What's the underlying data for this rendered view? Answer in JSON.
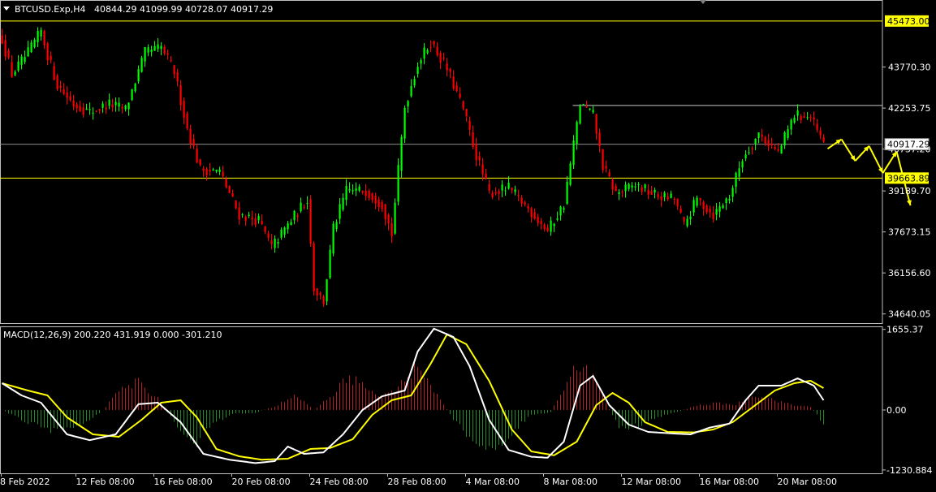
{
  "header": {
    "symbol_timeframe": "BTCUSD.Exp,H4",
    "ohlc": "40844.29 41099.99 40728.07 40917.29"
  },
  "macd_header": "MACD(12,26,9) 200.220 431.919 0.000 -301.210",
  "colors": {
    "background": "#000000",
    "bull_candle": "#00ff00",
    "bear_candle": "#ff0000",
    "grid_axis": "#c0c0c0",
    "level_line": "#ffff00",
    "macd_line": "#ffffff",
    "signal_line": "#ffff00",
    "hist_pos": "#b22222",
    "hist_neg": "#228b22",
    "arrow": "#ffff00"
  },
  "chart_data": [
    {
      "type": "candlestick",
      "panel": "price",
      "ylim": [
        34300,
        46250
      ],
      "y_ticks": [
        "43770.30",
        "42253.75",
        "40737.20",
        "39189.70",
        "37673.15",
        "36156.60",
        "34640.05"
      ],
      "horizontal_levels": [
        {
          "value": 45473.0,
          "label": "45473.00",
          "style": "yellow"
        },
        {
          "value": 40917.29,
          "label": "40917.29",
          "style": "gray"
        },
        {
          "value": 39663.89,
          "label": "39663.89",
          "style": "yellow"
        }
      ],
      "resistance_segment": {
        "value": 42350,
        "from": "8 Mar 08:00"
      },
      "close_path": [
        {
          "i": 0,
          "v": 44800
        },
        {
          "i": 3,
          "v": 43500
        },
        {
          "i": 8,
          "v": 44300
        },
        {
          "i": 12,
          "v": 45100
        },
        {
          "i": 14,
          "v": 44200
        },
        {
          "i": 17,
          "v": 43100
        },
        {
          "i": 22,
          "v": 42400
        },
        {
          "i": 27,
          "v": 42100
        },
        {
          "i": 33,
          "v": 42400
        },
        {
          "i": 38,
          "v": 42200
        },
        {
          "i": 44,
          "v": 44300
        },
        {
          "i": 49,
          "v": 44500
        },
        {
          "i": 53,
          "v": 43600
        },
        {
          "i": 57,
          "v": 41500
        },
        {
          "i": 61,
          "v": 40000
        },
        {
          "i": 67,
          "v": 39900
        },
        {
          "i": 73,
          "v": 38300
        },
        {
          "i": 79,
          "v": 38100
        },
        {
          "i": 83,
          "v": 37100
        },
        {
          "i": 89,
          "v": 38100
        },
        {
          "i": 94,
          "v": 38900
        },
        {
          "i": 96,
          "v": 35600
        },
        {
          "i": 99,
          "v": 35100
        },
        {
          "i": 102,
          "v": 37800
        },
        {
          "i": 106,
          "v": 39200
        },
        {
          "i": 112,
          "v": 39200
        },
        {
          "i": 117,
          "v": 38700
        },
        {
          "i": 120,
          "v": 37600
        },
        {
          "i": 124,
          "v": 42300
        },
        {
          "i": 128,
          "v": 43900
        },
        {
          "i": 132,
          "v": 44700
        },
        {
          "i": 137,
          "v": 43700
        },
        {
          "i": 142,
          "v": 42200
        },
        {
          "i": 146,
          "v": 40500
        },
        {
          "i": 150,
          "v": 39100
        },
        {
          "i": 156,
          "v": 39300
        },
        {
          "i": 163,
          "v": 38400
        },
        {
          "i": 168,
          "v": 37700
        },
        {
          "i": 173,
          "v": 38700
        },
        {
          "i": 178,
          "v": 42400
        },
        {
          "i": 182,
          "v": 42000
        },
        {
          "i": 185,
          "v": 40100
        },
        {
          "i": 189,
          "v": 39100
        },
        {
          "i": 195,
          "v": 39400
        },
        {
          "i": 202,
          "v": 39000
        },
        {
          "i": 207,
          "v": 38900
        },
        {
          "i": 210,
          "v": 37900
        },
        {
          "i": 214,
          "v": 38900
        },
        {
          "i": 219,
          "v": 38300
        },
        {
          "i": 224,
          "v": 39000
        },
        {
          "i": 228,
          "v": 40400
        },
        {
          "i": 233,
          "v": 41300
        },
        {
          "i": 239,
          "v": 40600
        },
        {
          "i": 244,
          "v": 42000
        },
        {
          "i": 249,
          "v": 41900
        },
        {
          "i": 253,
          "v": 40900
        }
      ],
      "n_bars": 254,
      "projection_arrows": [
        {
          "from": [
            40750,
            0
          ],
          "to": [
            41100,
            1
          ]
        },
        {
          "from": [
            41100,
            1
          ],
          "to": [
            40300,
            2
          ]
        },
        {
          "from": [
            40300,
            2
          ],
          "to": [
            40850,
            3
          ]
        },
        {
          "from": [
            40850,
            3
          ],
          "to": [
            39850,
            4
          ]
        },
        {
          "from": [
            39850,
            4
          ],
          "to": [
            40650,
            5
          ]
        },
        {
          "from": [
            40650,
            5
          ],
          "to": [
            38650,
            6
          ]
        }
      ]
    },
    {
      "type": "macd",
      "panel": "indicator",
      "ylim": [
        -1300,
        1700
      ],
      "y_ticks": [
        "1655.37",
        "0.00",
        "-1230.884"
      ],
      "macd_line": [
        {
          "i": 0,
          "v": 550
        },
        {
          "i": 6,
          "v": 300
        },
        {
          "i": 12,
          "v": 150
        },
        {
          "i": 20,
          "v": -500
        },
        {
          "i": 27,
          "v": -620
        },
        {
          "i": 35,
          "v": -500
        },
        {
          "i": 42,
          "v": 120
        },
        {
          "i": 48,
          "v": 150
        },
        {
          "i": 55,
          "v": -250
        },
        {
          "i": 62,
          "v": -900
        },
        {
          "i": 70,
          "v": -1020
        },
        {
          "i": 78,
          "v": -1090
        },
        {
          "i": 84,
          "v": -1050
        },
        {
          "i": 88,
          "v": -750
        },
        {
          "i": 93,
          "v": -900
        },
        {
          "i": 99,
          "v": -870
        },
        {
          "i": 105,
          "v": -500
        },
        {
          "i": 111,
          "v": 0
        },
        {
          "i": 117,
          "v": 280
        },
        {
          "i": 124,
          "v": 400
        },
        {
          "i": 128,
          "v": 1200
        },
        {
          "i": 133,
          "v": 1670
        },
        {
          "i": 139,
          "v": 1500
        },
        {
          "i": 144,
          "v": 900
        },
        {
          "i": 150,
          "v": -200
        },
        {
          "i": 156,
          "v": -820
        },
        {
          "i": 163,
          "v": -960
        },
        {
          "i": 168,
          "v": -980
        },
        {
          "i": 173,
          "v": -650
        },
        {
          "i": 178,
          "v": 500
        },
        {
          "i": 182,
          "v": 700
        },
        {
          "i": 187,
          "v": 100
        },
        {
          "i": 193,
          "v": -300
        },
        {
          "i": 199,
          "v": -450
        },
        {
          "i": 206,
          "v": -480
        },
        {
          "i": 212,
          "v": -500
        },
        {
          "i": 218,
          "v": -360
        },
        {
          "i": 224,
          "v": -280
        },
        {
          "i": 229,
          "v": 200
        },
        {
          "i": 233,
          "v": 500
        },
        {
          "i": 240,
          "v": 500
        },
        {
          "i": 245,
          "v": 650
        },
        {
          "i": 250,
          "v": 500
        },
        {
          "i": 253,
          "v": 200
        }
      ],
      "signal_line": [
        {
          "i": 0,
          "v": 550
        },
        {
          "i": 8,
          "v": 400
        },
        {
          "i": 14,
          "v": 300
        },
        {
          "i": 20,
          "v": -150
        },
        {
          "i": 28,
          "v": -500
        },
        {
          "i": 36,
          "v": -550
        },
        {
          "i": 43,
          "v": -200
        },
        {
          "i": 49,
          "v": 150
        },
        {
          "i": 55,
          "v": 200
        },
        {
          "i": 60,
          "v": -150
        },
        {
          "i": 66,
          "v": -800
        },
        {
          "i": 73,
          "v": -950
        },
        {
          "i": 80,
          "v": -1020
        },
        {
          "i": 88,
          "v": -1000
        },
        {
          "i": 95,
          "v": -800
        },
        {
          "i": 101,
          "v": -780
        },
        {
          "i": 108,
          "v": -600
        },
        {
          "i": 114,
          "v": -100
        },
        {
          "i": 120,
          "v": 200
        },
        {
          "i": 126,
          "v": 300
        },
        {
          "i": 132,
          "v": 950
        },
        {
          "i": 137,
          "v": 1550
        },
        {
          "i": 143,
          "v": 1350
        },
        {
          "i": 150,
          "v": 600
        },
        {
          "i": 157,
          "v": -400
        },
        {
          "i": 163,
          "v": -850
        },
        {
          "i": 170,
          "v": -930
        },
        {
          "i": 177,
          "v": -650
        },
        {
          "i": 183,
          "v": 100
        },
        {
          "i": 188,
          "v": 350
        },
        {
          "i": 193,
          "v": 150
        },
        {
          "i": 198,
          "v": -250
        },
        {
          "i": 205,
          "v": -450
        },
        {
          "i": 213,
          "v": -460
        },
        {
          "i": 219,
          "v": -400
        },
        {
          "i": 225,
          "v": -250
        },
        {
          "i": 232,
          "v": 100
        },
        {
          "i": 238,
          "v": 400
        },
        {
          "i": 244,
          "v": 550
        },
        {
          "i": 249,
          "v": 600
        },
        {
          "i": 253,
          "v": 450
        }
      ],
      "histogram_path": [
        {
          "i": 0,
          "v": 0
        },
        {
          "i": 6,
          "v": -200
        },
        {
          "i": 14,
          "v": -450
        },
        {
          "i": 22,
          "v": -380
        },
        {
          "i": 30,
          "v": -80
        },
        {
          "i": 36,
          "v": 400
        },
        {
          "i": 42,
          "v": 650
        },
        {
          "i": 48,
          "v": 250
        },
        {
          "i": 54,
          "v": -350
        },
        {
          "i": 60,
          "v": -700
        },
        {
          "i": 66,
          "v": -250
        },
        {
          "i": 72,
          "v": -80
        },
        {
          "i": 78,
          "v": -60
        },
        {
          "i": 84,
          "v": 80
        },
        {
          "i": 90,
          "v": 350
        },
        {
          "i": 96,
          "v": 0
        },
        {
          "i": 102,
          "v": 350
        },
        {
          "i": 106,
          "v": 700
        },
        {
          "i": 110,
          "v": 650
        },
        {
          "i": 115,
          "v": 300
        },
        {
          "i": 121,
          "v": 400
        },
        {
          "i": 127,
          "v": 950
        },
        {
          "i": 133,
          "v": 450
        },
        {
          "i": 139,
          "v": -200
        },
        {
          "i": 145,
          "v": -650
        },
        {
          "i": 151,
          "v": -900
        },
        {
          "i": 157,
          "v": -500
        },
        {
          "i": 163,
          "v": -100
        },
        {
          "i": 169,
          "v": -50
        },
        {
          "i": 175,
          "v": 800
        },
        {
          "i": 180,
          "v": 950
        },
        {
          "i": 185,
          "v": 300
        },
        {
          "i": 190,
          "v": -400
        },
        {
          "i": 196,
          "v": -350
        },
        {
          "i": 202,
          "v": -150
        },
        {
          "i": 208,
          "v": -40
        },
        {
          "i": 214,
          "v": 100
        },
        {
          "i": 220,
          "v": 150
        },
        {
          "i": 226,
          "v": 120
        },
        {
          "i": 232,
          "v": 350
        },
        {
          "i": 238,
          "v": 220
        },
        {
          "i": 244,
          "v": 100
        },
        {
          "i": 249,
          "v": 80
        },
        {
          "i": 253,
          "v": -300
        }
      ]
    }
  ],
  "x_axis_labels": [
    {
      "text": "8 Feb 2022",
      "i": 0
    },
    {
      "text": "12 Feb 08:00",
      "i": 23
    },
    {
      "text": "16 Feb 08:00",
      "i": 47
    },
    {
      "text": "20 Feb 08:00",
      "i": 71
    },
    {
      "text": "24 Feb 08:00",
      "i": 95
    },
    {
      "text": "28 Feb 08:00",
      "i": 119
    },
    {
      "text": "4 Mar 08:00",
      "i": 143
    },
    {
      "text": "8 Mar 08:00",
      "i": 167
    },
    {
      "text": "12 Mar 08:00",
      "i": 191
    },
    {
      "text": "16 Mar 08:00",
      "i": 215
    },
    {
      "text": "20 Mar 08:00",
      "i": 239
    }
  ]
}
